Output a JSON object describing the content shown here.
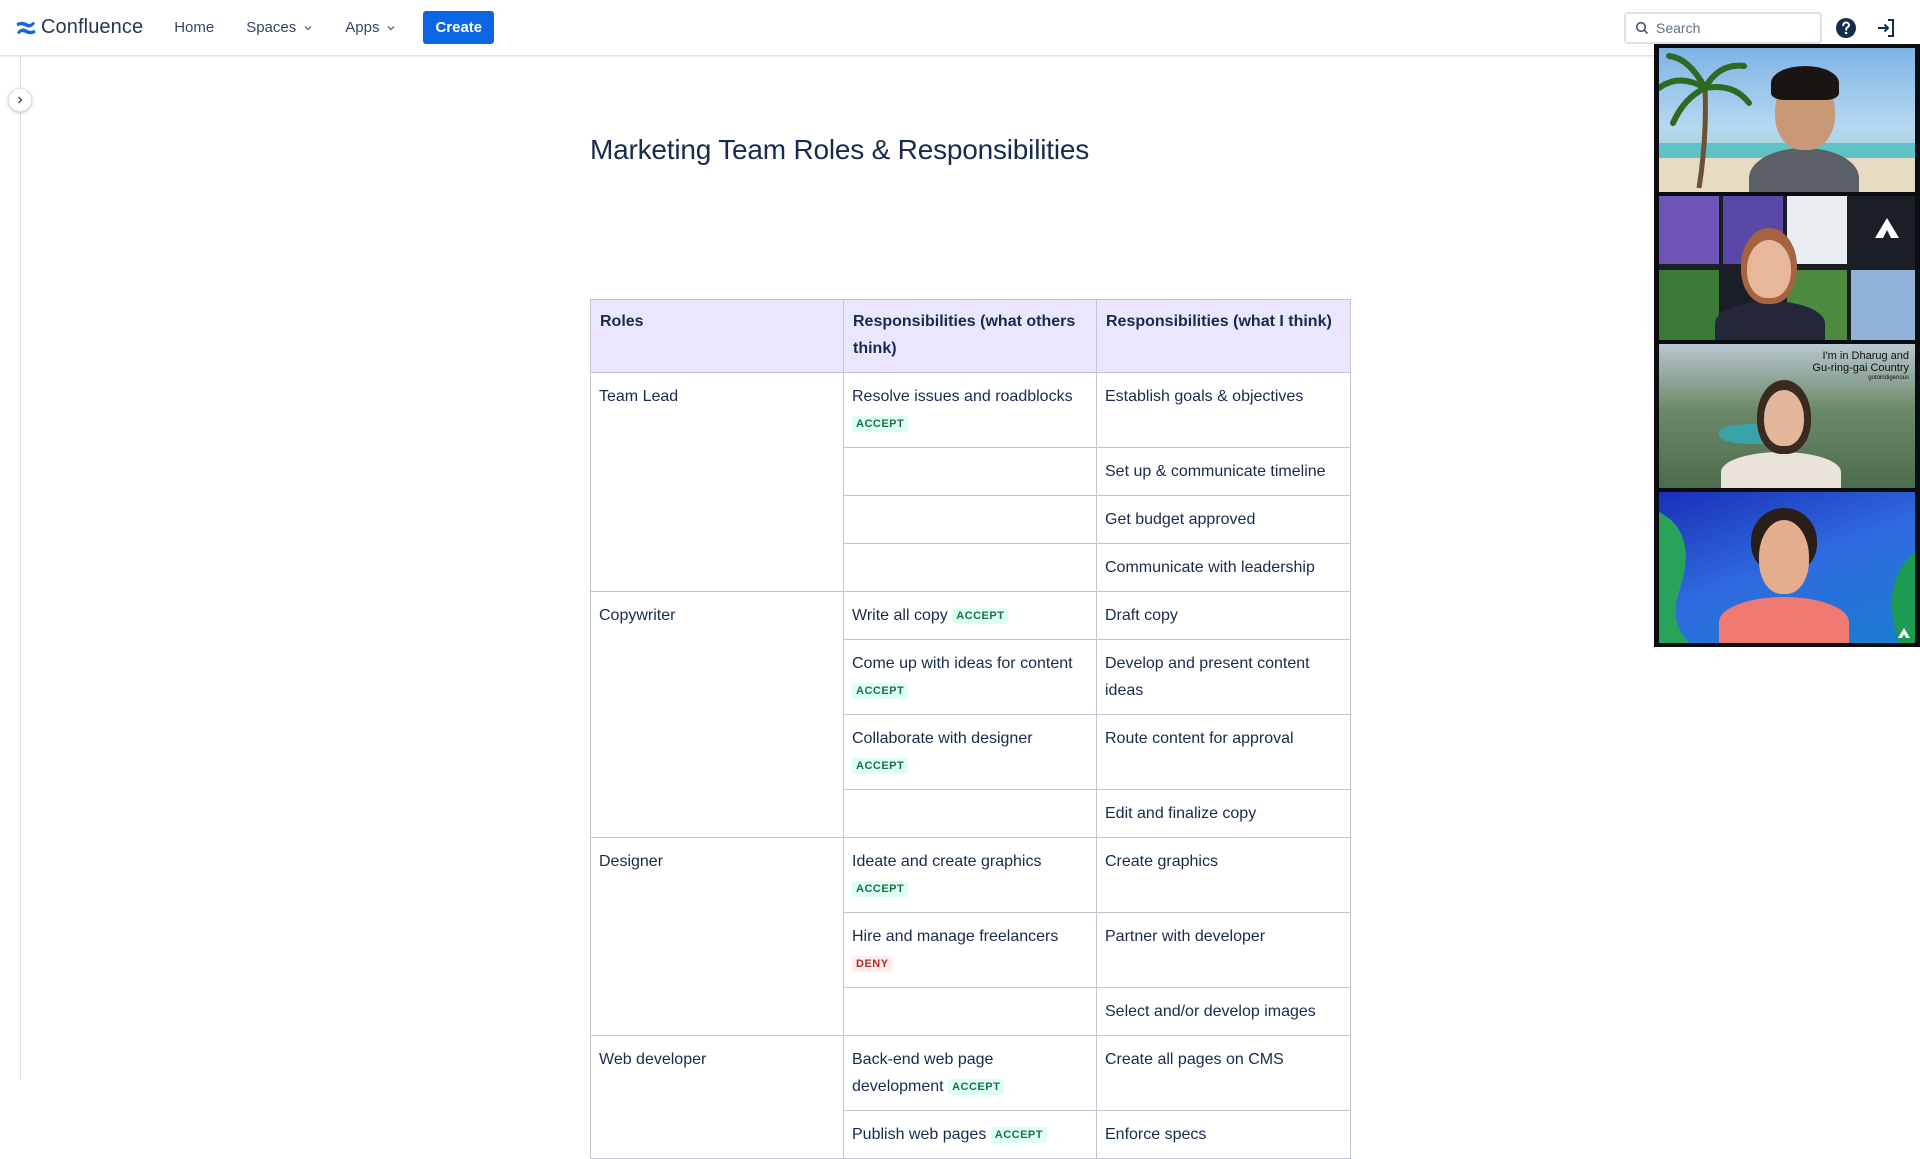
{
  "nav": {
    "brand": "Confluence",
    "home": "Home",
    "spaces": "Spaces",
    "apps": "Apps",
    "create": "Create",
    "search_placeholder": "Search"
  },
  "page": {
    "title": "Marketing Team Roles & Responsibilities"
  },
  "table": {
    "headers": [
      "Roles",
      "Responsibilities (what others think)",
      "Responsibilities (what I think)"
    ],
    "roles": [
      "Team Lead",
      "Copywriter",
      "Designer",
      "Web developer"
    ],
    "rows": [
      {
        "others": "Resolve issues and roadblocks",
        "status": "ACCEPT",
        "mine": "Establish goals & objectives"
      },
      {
        "others": "",
        "status": "",
        "mine": "Set up & communicate timeline"
      },
      {
        "others": "",
        "status": "",
        "mine": "Get budget approved"
      },
      {
        "others": "",
        "status": "",
        "mine": "Communicate with leadership"
      },
      {
        "others": "Write all copy",
        "status": "ACCEPT",
        "mine": "Draft copy"
      },
      {
        "others": "Come up with ideas for content",
        "status": "ACCEPT",
        "mine": "Develop and present content ideas"
      },
      {
        "others": "Collaborate with designer",
        "status": "ACCEPT",
        "mine": "Route content for approval"
      },
      {
        "others": "",
        "status": "",
        "mine": "Edit and finalize copy"
      },
      {
        "others": "Ideate and create graphics",
        "status": "ACCEPT",
        "mine": "Create graphics"
      },
      {
        "others": "Hire and manage freelancers",
        "status": "DENY",
        "mine": "Partner with developer"
      },
      {
        "others": "",
        "status": "",
        "mine": "Select and/or develop images"
      },
      {
        "others": "Back-end web page development",
        "status": "ACCEPT",
        "mine": "Create all pages on CMS"
      },
      {
        "others": "Publish web pages",
        "status": "ACCEPT",
        "mine": "Enforce specs"
      }
    ]
  },
  "video_call": {
    "caption_line1": "I'm in Dharug and",
    "caption_line2": "Gu-ring-gai Country",
    "caption_small": "gotoindigenous"
  },
  "colors": {
    "create_button": "#0c66e4",
    "header_bg": "#eae6ff",
    "accept_bg": "#dcfff1",
    "accept_text": "#216e4e",
    "deny_bg": "#ffeceb",
    "deny_text": "#ae2e24"
  },
  "icons": [
    "confluence-logo-icon",
    "chevron-down-icon",
    "search-icon",
    "help-icon",
    "sign-in-icon",
    "chevron-right-icon",
    "atlassian-logo-icon"
  ]
}
